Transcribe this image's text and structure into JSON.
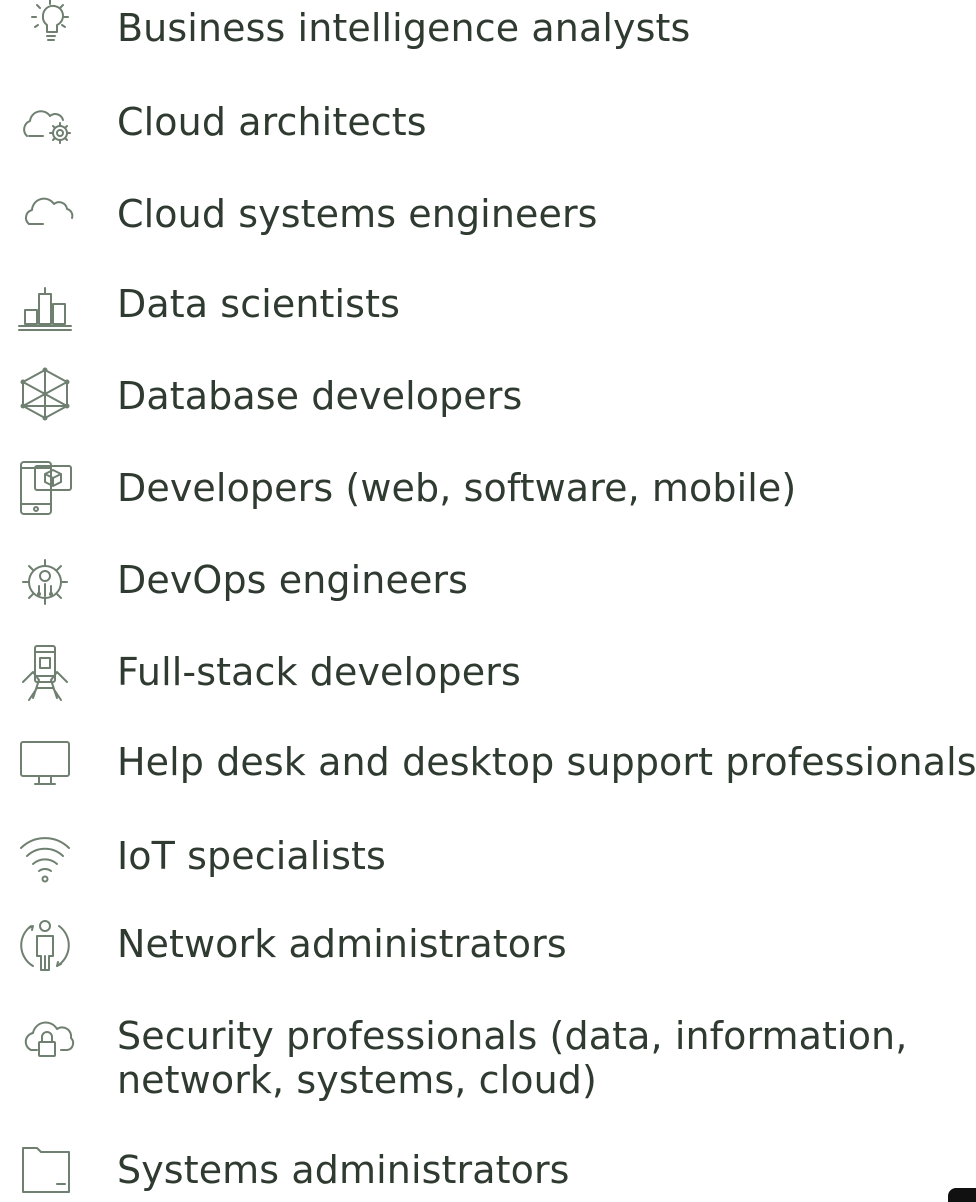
{
  "roles": [
    {
      "label": "Business intelligence analysts",
      "icon": "lightbulb-icon"
    },
    {
      "label": "Cloud architects",
      "icon": "cloud-gear-icon"
    },
    {
      "label": "Cloud systems engineers",
      "icon": "cloud-icon"
    },
    {
      "label": "Data scientists",
      "icon": "bar-chart-icon"
    },
    {
      "label": "Database developers",
      "icon": "cube-network-icon"
    },
    {
      "label": "Developers (web, software, mobile)",
      "icon": "devices-icon"
    },
    {
      "label": "DevOps engineers",
      "icon": "gear-circuit-icon"
    },
    {
      "label": "Full-stack developers",
      "icon": "phone-hands-icon"
    },
    {
      "label": "Help desk and desktop support professionals",
      "icon": "monitor-icon"
    },
    {
      "label": "IoT specialists",
      "icon": "wifi-icon"
    },
    {
      "label": "Network administrators",
      "icon": "person-cycle-icon"
    },
    {
      "label": "Security professionals (data, information,",
      "label2": "network, systems, cloud)",
      "icon": "cloud-lock-icon"
    },
    {
      "label": "Systems administrators",
      "icon": "folder-icon"
    }
  ],
  "colors": {
    "text": "#2f3a30",
    "icon": "#6f7f70"
  }
}
